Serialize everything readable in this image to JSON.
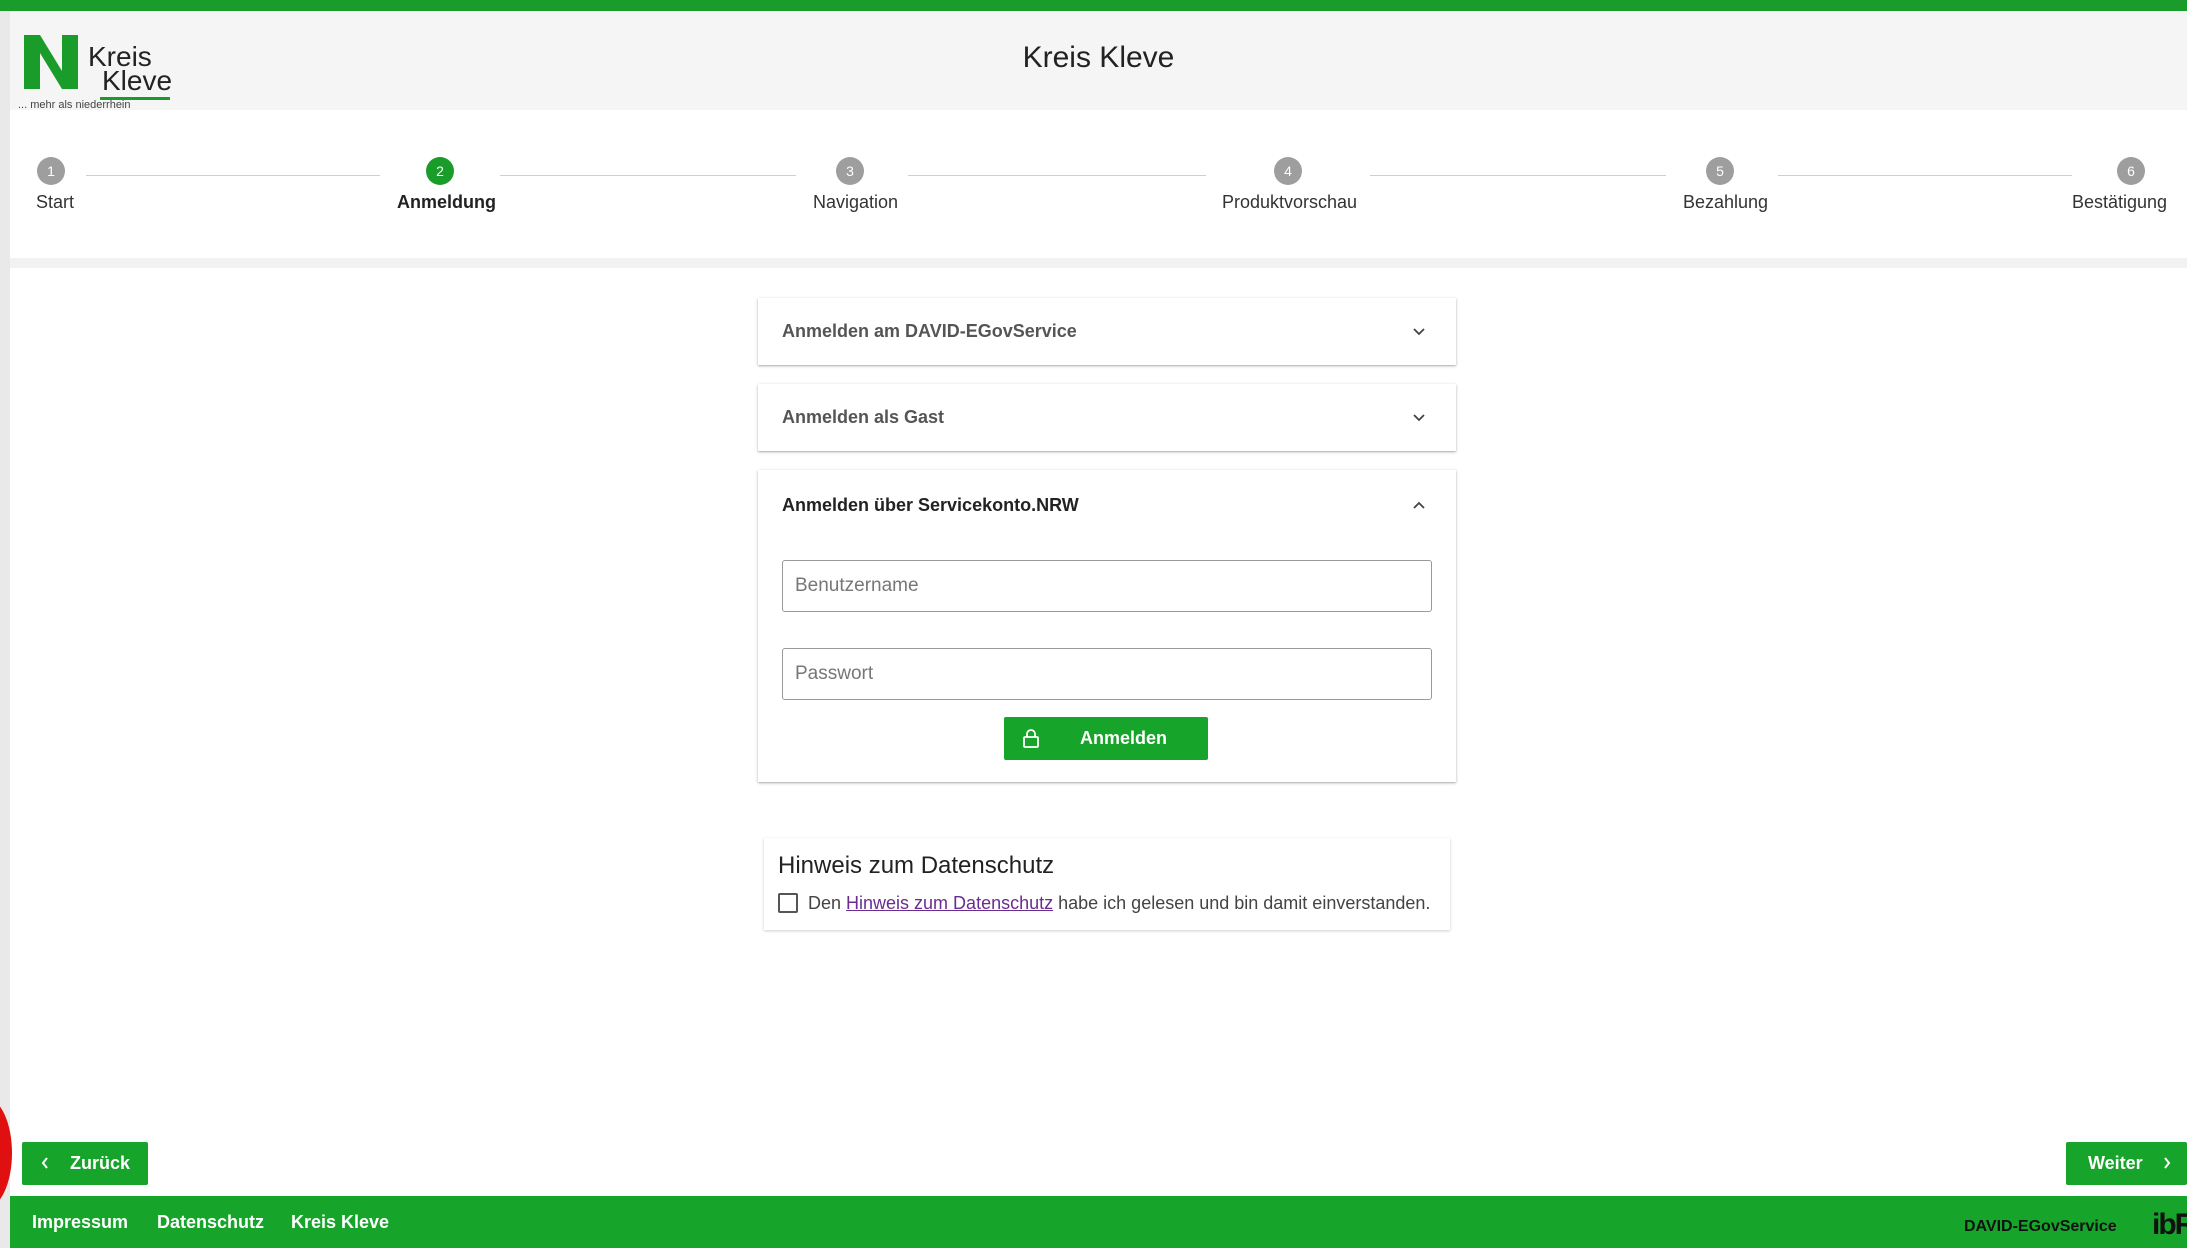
{
  "header": {
    "logo_line1": "Kreis",
    "logo_line2": "Kleve",
    "logo_tagline": "... mehr als niederrhein",
    "title": "Kreis Kleve"
  },
  "steps": [
    {
      "number": "1",
      "label": "Start",
      "active": false
    },
    {
      "number": "2",
      "label": "Anmeldung",
      "active": true
    },
    {
      "number": "3",
      "label": "Navigation",
      "active": false
    },
    {
      "number": "4",
      "label": "Produktvorschau",
      "active": false
    },
    {
      "number": "5",
      "label": "Bezahlung",
      "active": false
    },
    {
      "number": "6",
      "label": "Bestätigung",
      "active": false
    }
  ],
  "panels": {
    "david": {
      "title": "Anmelden am DAVID-EGovService",
      "expanded": false
    },
    "guest": {
      "title": "Anmelden als Gast",
      "expanded": false
    },
    "nrw": {
      "title": "Anmelden über Servicekonto.NRW",
      "expanded": true,
      "username_placeholder": "Benutzername",
      "username_value": "",
      "password_placeholder": "Passwort",
      "password_value": "",
      "login_button": "Anmelden"
    }
  },
  "privacy": {
    "title": "Hinweis zum Datenschutz",
    "text_before": "Den ",
    "link_text": "Hinweis zum Datenschutz",
    "text_after": " habe ich gelesen und bin damit einverstanden.",
    "checked": false
  },
  "navigation": {
    "back_label": "Zurück",
    "next_label": "Weiter"
  },
  "footer": {
    "links": [
      "Impressum",
      "Datenschutz",
      "Kreis Kleve"
    ],
    "brand": "DAVID-EGovService",
    "brand_logo": "ibR"
  },
  "colors": {
    "brand_green": "#17a42a",
    "step_inactive": "#9e9e9e",
    "link_purple": "#6a2c91"
  }
}
